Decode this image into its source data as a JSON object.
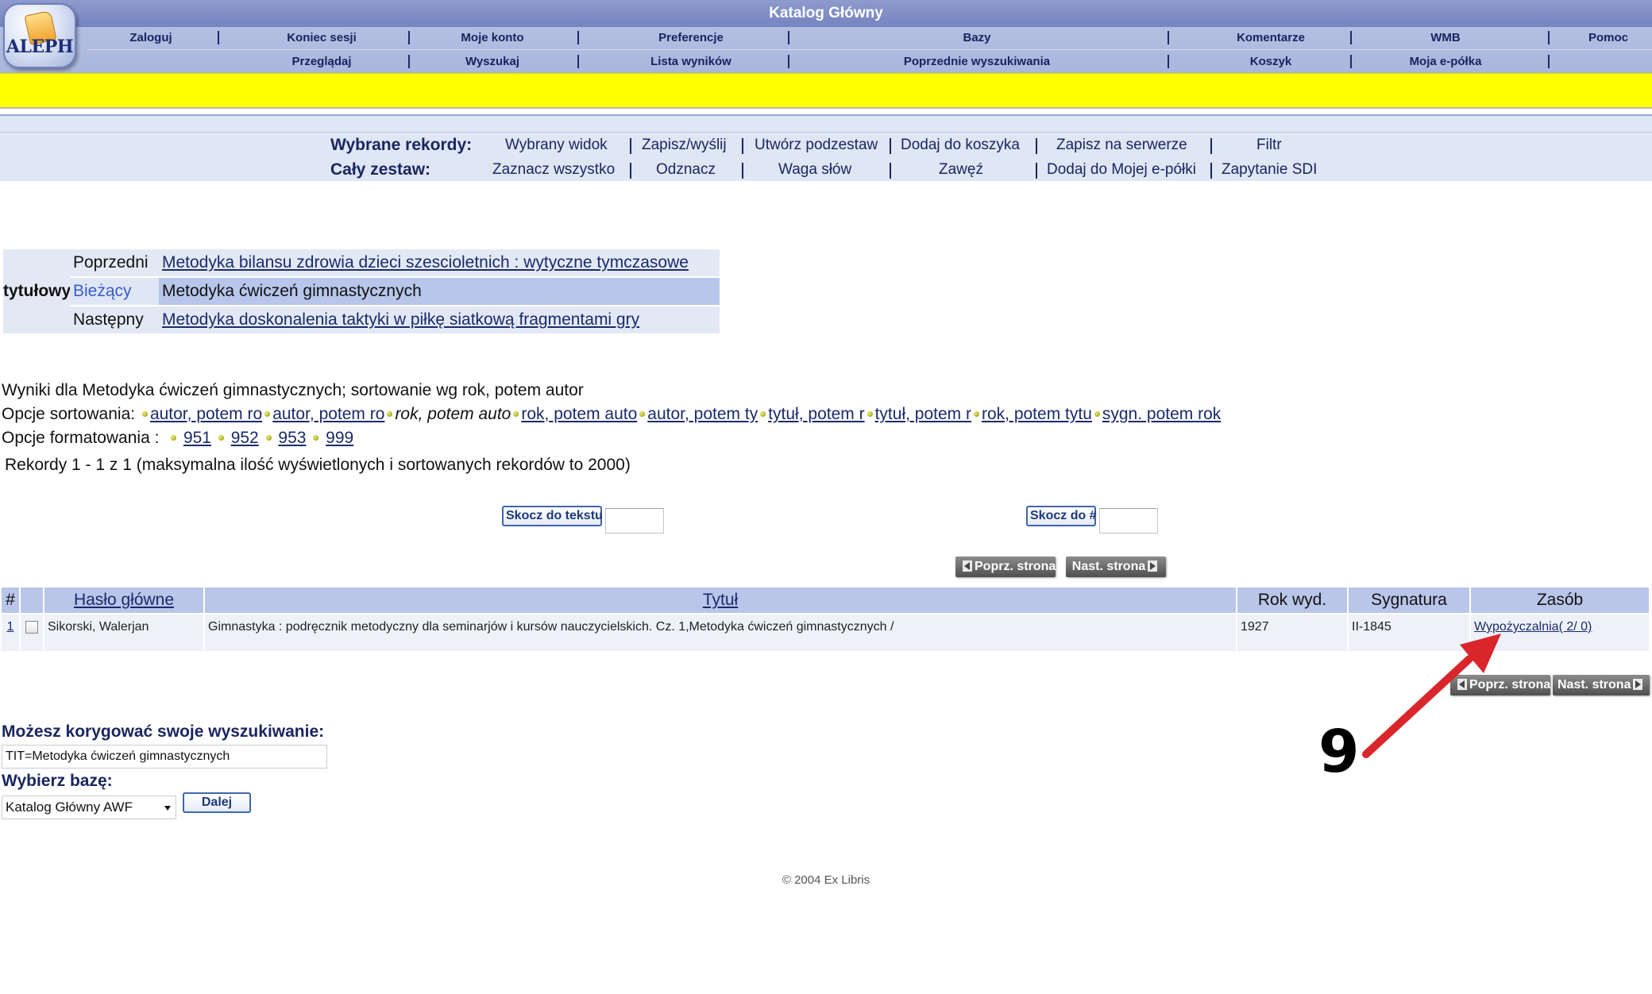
{
  "header": {
    "title": "Katalog Główny",
    "logo_text": "ALEPH",
    "nav_row1": [
      "Zaloguj",
      "Koniec sesji",
      "Moje konto",
      "Preferencje",
      "Bazy",
      "Komentarze",
      "WMB",
      "Pomoc"
    ],
    "nav_row2": [
      "Przeglądaj",
      "Wyszukaj",
      "Lista wyników",
      "Poprzednie wyszukiwania",
      "Koszyk",
      "Moja e-półka"
    ]
  },
  "toolbar": {
    "selected_label": "Wybrane rekordy:",
    "selected_items": [
      "Wybrany widok",
      "Zapisz/wyślij",
      "Utwórz podzestaw",
      "Dodaj do koszyka",
      "Zapisz na serwerze",
      "Filtr"
    ],
    "whole_label": "Cały zestaw:",
    "whole_items": [
      "Zaznacz wszystko",
      "Odznacz",
      "Waga słów",
      "Zawęź",
      "Dodaj do Mojej e-półki",
      "Zapytanie SDI"
    ]
  },
  "browse": {
    "index_label": "tytułowy",
    "rows": [
      {
        "label": "Poprzedni",
        "value": "Metodyka bilansu zdrowia dzieci szescioletnich : wytyczne tymczasowe"
      },
      {
        "label": "Bieżący",
        "value": "Metodyka ćwiczeń gimnastycznych"
      },
      {
        "label": "Następny",
        "value": "Metodyka doskonalenia taktyki w piłkę siatkową fragmentami gry"
      }
    ]
  },
  "results_info": {
    "heading": "Wyniki dla Metodyka ćwiczeń gimnastycznych; sortowanie wg rok, potem autor",
    "sort_label": "Opcje sortowania:",
    "sort_options": [
      "autor, potem ro",
      "autor, potem ro",
      "rok, potem auto",
      "rok, potem auto",
      "autor, potem ty",
      "tytuł, potem r",
      "tytuł, potem r",
      "rok, potem tytu",
      "sygn. potem rok"
    ],
    "sort_selected_index": 2,
    "format_label": "Opcje formatowania :",
    "format_options": [
      "951",
      "952",
      "953",
      "999"
    ],
    "records_text": "Rekordy 1 - 1 z 1 (maksymalna ilość wyświetlonych i sortowanych rekordów to 2000)"
  },
  "jump": {
    "text_button": "Skocz do tekstu",
    "num_button": "Skocz do #"
  },
  "pagination": {
    "prev": "Poprz. strona",
    "next": "Nast. strona"
  },
  "table": {
    "headers": [
      "#",
      "",
      "Hasło główne",
      "Tytuł",
      "Rok wyd.",
      "Sygnatura",
      "Zasób"
    ],
    "rows": [
      {
        "num": "1",
        "author": "Sikorski, Walerjan",
        "title": "Gimnastyka : podręcznik metodyczny dla seminarjów i kursów nauczycielskich. Cz. 1,Metodyka ćwiczeń gimnastycznych /",
        "year": "1927",
        "signature": "II-1845",
        "holdings": "Wypożyczalnia( 2/ 0)"
      }
    ]
  },
  "refine": {
    "label": "Możesz korygować swoje wyszukiwanie:",
    "query": "TIT=Metodyka ćwiczeń gimnastycznych",
    "db_label": "Wybierz bazę:",
    "db_selected": "Katalog Główny AWF",
    "submit": "Dalej"
  },
  "footer": "© 2004 Ex Libris",
  "annotation": {
    "number": "9",
    "arrow_color": "#d9262b"
  }
}
